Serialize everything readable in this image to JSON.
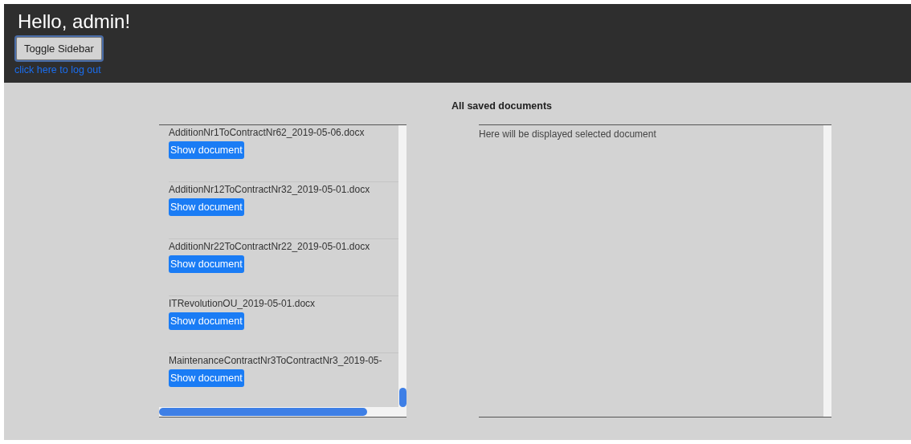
{
  "header": {
    "greeting": "Hello, admin!",
    "toggle_button": "Toggle Sidebar",
    "logout_link": "click here to log out"
  },
  "documents": {
    "title": "All saved documents",
    "items": [
      {
        "name": "AdditionNr1ToContractNr62_2019-05-06.docx",
        "button": "Show document"
      },
      {
        "name": "AdditionNr12ToContractNr32_2019-05-01.docx",
        "button": "Show document"
      },
      {
        "name": "AdditionNr22ToContractNr22_2019-05-01.docx",
        "button": "Show document"
      },
      {
        "name": "ITRevolutionOU_2019-05-01.docx",
        "button": "Show document"
      },
      {
        "name": "MaintenanceContractNr3ToContractNr3_2019-05-",
        "button": "Show document"
      }
    ]
  },
  "viewer": {
    "message": "Here will be displayed selected document"
  }
}
